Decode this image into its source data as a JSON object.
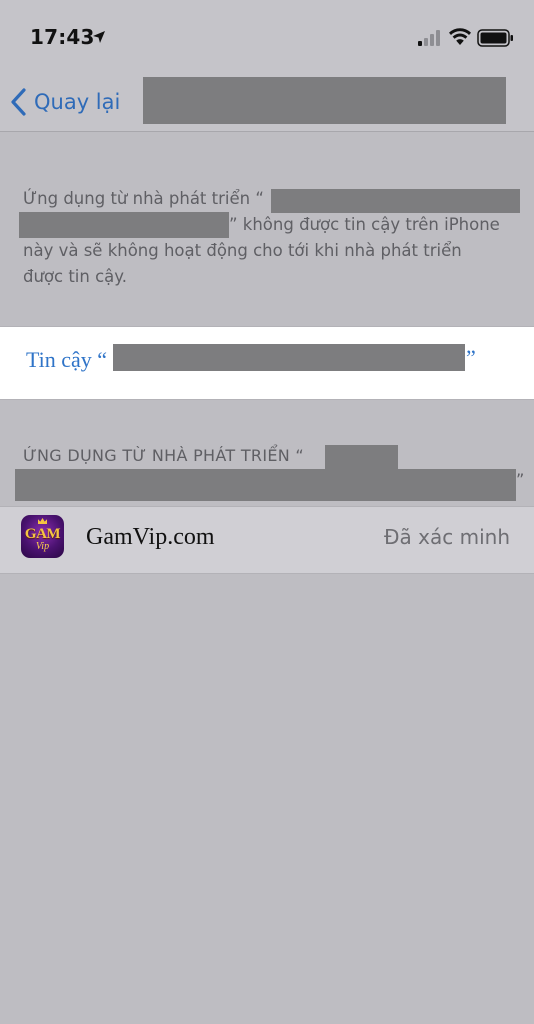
{
  "status_bar": {
    "time": "17:43",
    "icons": [
      "location-arrow-icon",
      "cellular-signal-icon",
      "wifi-icon",
      "battery-icon"
    ]
  },
  "navbar": {
    "back_label": "Quay lại",
    "title_redacted": true
  },
  "description": {
    "line1_prefix": "Ứng dụng từ nhà phát triển “",
    "line2_suffix": "” không được tin cậy trên iPhone",
    "line3": "này và sẽ không hoạt động cho tới khi nhà phát triển",
    "line4": "được tin cậy."
  },
  "trust_action": {
    "label_prefix": "Tin cậy “",
    "label_suffix": "”"
  },
  "section": {
    "header_prefix": "ỨNG DỤNG TỪ NHÀ PHÁT TRIỂN “",
    "header_suffix": "”"
  },
  "app": {
    "icon": "gamvip-app-icon",
    "icon_text": "GAM",
    "icon_subtext": "Vip",
    "name": "GamVip.com",
    "status": "Đã xác minh"
  },
  "colors": {
    "accent": "#2f74c8",
    "background": "#bebdc2",
    "redaction": "#7d7d7f"
  }
}
